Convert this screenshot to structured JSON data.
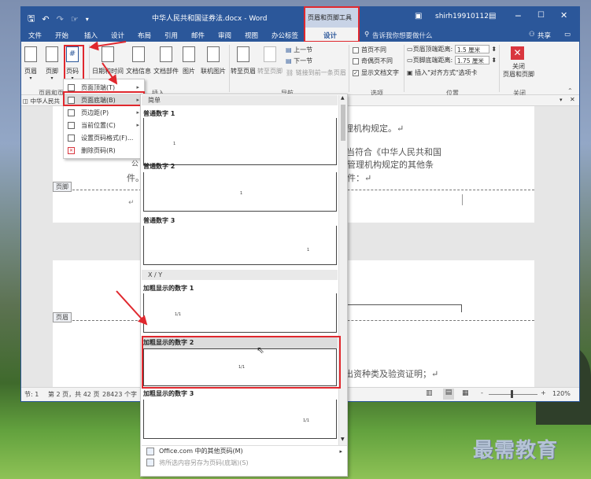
{
  "titlebar": {
    "doc_title": "中华人民共和国证券法.docx - Word",
    "context_tool": "页眉和页脚工具",
    "user": "shirh19910112",
    "qat": [
      "保存",
      "撤销",
      "恢复",
      "触摸模式",
      "自定义"
    ]
  },
  "ribbon_tabs": [
    "文件",
    "开始",
    "插入",
    "设计",
    "布局",
    "引用",
    "邮件",
    "审阅",
    "视图",
    "办公标签",
    "设计"
  ],
  "tell_me": "告诉我你想要做什么",
  "share": "共享",
  "ribbon": {
    "header_btn": "页眉",
    "footer_btn": "页脚",
    "page_number_btn": "页码",
    "datetime_btn": "日期和时间",
    "docinfo_btn": "文档信息",
    "docparts_btn": "文档部件",
    "picture_btn": "图片",
    "online_picture_btn": "联机图片",
    "goto_header_btn": "转至页眉",
    "goto_footer_btn": "转至页脚",
    "prev_section": "上一节",
    "next_section": "下一节",
    "link_previous": "链接到前一条页眉",
    "opt_first_page": "首页不同",
    "opt_odd_even": "奇偶页不同",
    "opt_show_text": "显示文档文字",
    "header_top_label": "页眉顶端距离:",
    "header_top_value": "1.5 厘米",
    "footer_bottom_label": "页脚底端距离:",
    "footer_bottom_value": "1.75 厘米",
    "align_tab": "插入\"对齐方式\"选项卡",
    "close_btn": "关闭\n页眉和页脚",
    "groups": {
      "hf": "页眉和页脚",
      "insert": "插入",
      "nav": "导航",
      "options": "选项",
      "position": "位置",
      "close": "关闭"
    }
  },
  "nav_tab_label": "中华人民共",
  "context_menu": [
    {
      "label": "页面顶端(T)",
      "arrow": "▸"
    },
    {
      "label": "页面底端(B)",
      "arrow": "▸"
    },
    {
      "label": "页边距(P)",
      "arrow": "▸"
    },
    {
      "label": "当前位置(C)",
      "arrow": "▸"
    },
    {
      "label": "设置页码格式(F)...",
      "arrow": ""
    },
    {
      "label": "删除页码(R)",
      "arrow": ""
    }
  ],
  "gallery": {
    "section_simple": "简单",
    "plain1": "普通数字 1",
    "plain2": "普通数字 2",
    "plain3": "普通数字 3",
    "section_xy": "X / Y",
    "bold1": "加粗显示的数字 1",
    "bold2": "加粗显示的数字 2",
    "bold3": "加粗显示的数字 3",
    "num_plain": "1",
    "num_xy": "1/1",
    "more": "Office.com 中的其他页码(M)",
    "save_sel": "将所选内容另存为页码(底端)(S)"
  },
  "document": {
    "line1": "管理机构规定。↵",
    "line2": "应当符合《中华人民共和国",
    "line3": "督管理机构规定的其他条",
    "line4": "文件：↵",
    "frag_jian": "件。",
    "frag_gong": "公",
    "line5": "、出资种类及验资证明；↵",
    "footer_tag": "页脚",
    "header_tag": "页眉"
  },
  "status": {
    "section": "节: 1",
    "page": "第 2 页，共 42 页",
    "words": "28423 个字",
    "zoom": "120%",
    "zoom_minus": "-",
    "zoom_plus": "+"
  },
  "watermark": "最需教育",
  "colors": {
    "accent": "#2b579a",
    "highlight_red": "#e0282e"
  }
}
